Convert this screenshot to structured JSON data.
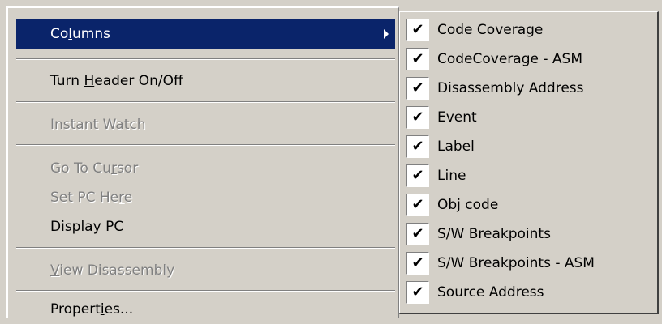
{
  "context_menu": {
    "items": [
      {
        "label_pre": "Co",
        "label_u": "l",
        "label_post": "umns",
        "state": "highlighted",
        "has_submenu": true
      },
      {
        "label_pre": "Turn ",
        "label_u": "H",
        "label_post": "eader On/Off",
        "state": "enabled"
      },
      {
        "label": "Instant Watch",
        "state": "disabled"
      },
      {
        "label_pre": "Go To Cu",
        "label_u": "r",
        "label_post": "sor",
        "state": "disabled"
      },
      {
        "label_pre": "Set PC He",
        "label_u": "r",
        "label_post": "e",
        "state": "disabled"
      },
      {
        "label_pre": "Displa",
        "label_u": "y",
        "label_post": " PC",
        "state": "enabled"
      },
      {
        "label_pre": "",
        "label_u": "V",
        "label_post": "iew Disassembly",
        "state": "disabled"
      },
      {
        "label_pre": "Propert",
        "label_u": "i",
        "label_post": "es...",
        "state": "enabled"
      }
    ]
  },
  "columns_submenu": {
    "check_glyph": "✔",
    "items": [
      {
        "label": "Code Coverage",
        "checked": true
      },
      {
        "label": "CodeCoverage - ASM",
        "checked": true
      },
      {
        "label": "Disassembly Address",
        "checked": true
      },
      {
        "label": "Event",
        "checked": true
      },
      {
        "label": "Label",
        "checked": true
      },
      {
        "label": "Line",
        "checked": true
      },
      {
        "label": "Obj code",
        "checked": true
      },
      {
        "label": "S/W Breakpoints",
        "checked": true
      },
      {
        "label": "S/W Breakpoints - ASM",
        "checked": true
      },
      {
        "label": "Source Address",
        "checked": true
      }
    ]
  },
  "colors": {
    "menu_bg": "#d4d0c8",
    "highlight_bg": "#0a246a",
    "disabled_text": "#808080"
  }
}
